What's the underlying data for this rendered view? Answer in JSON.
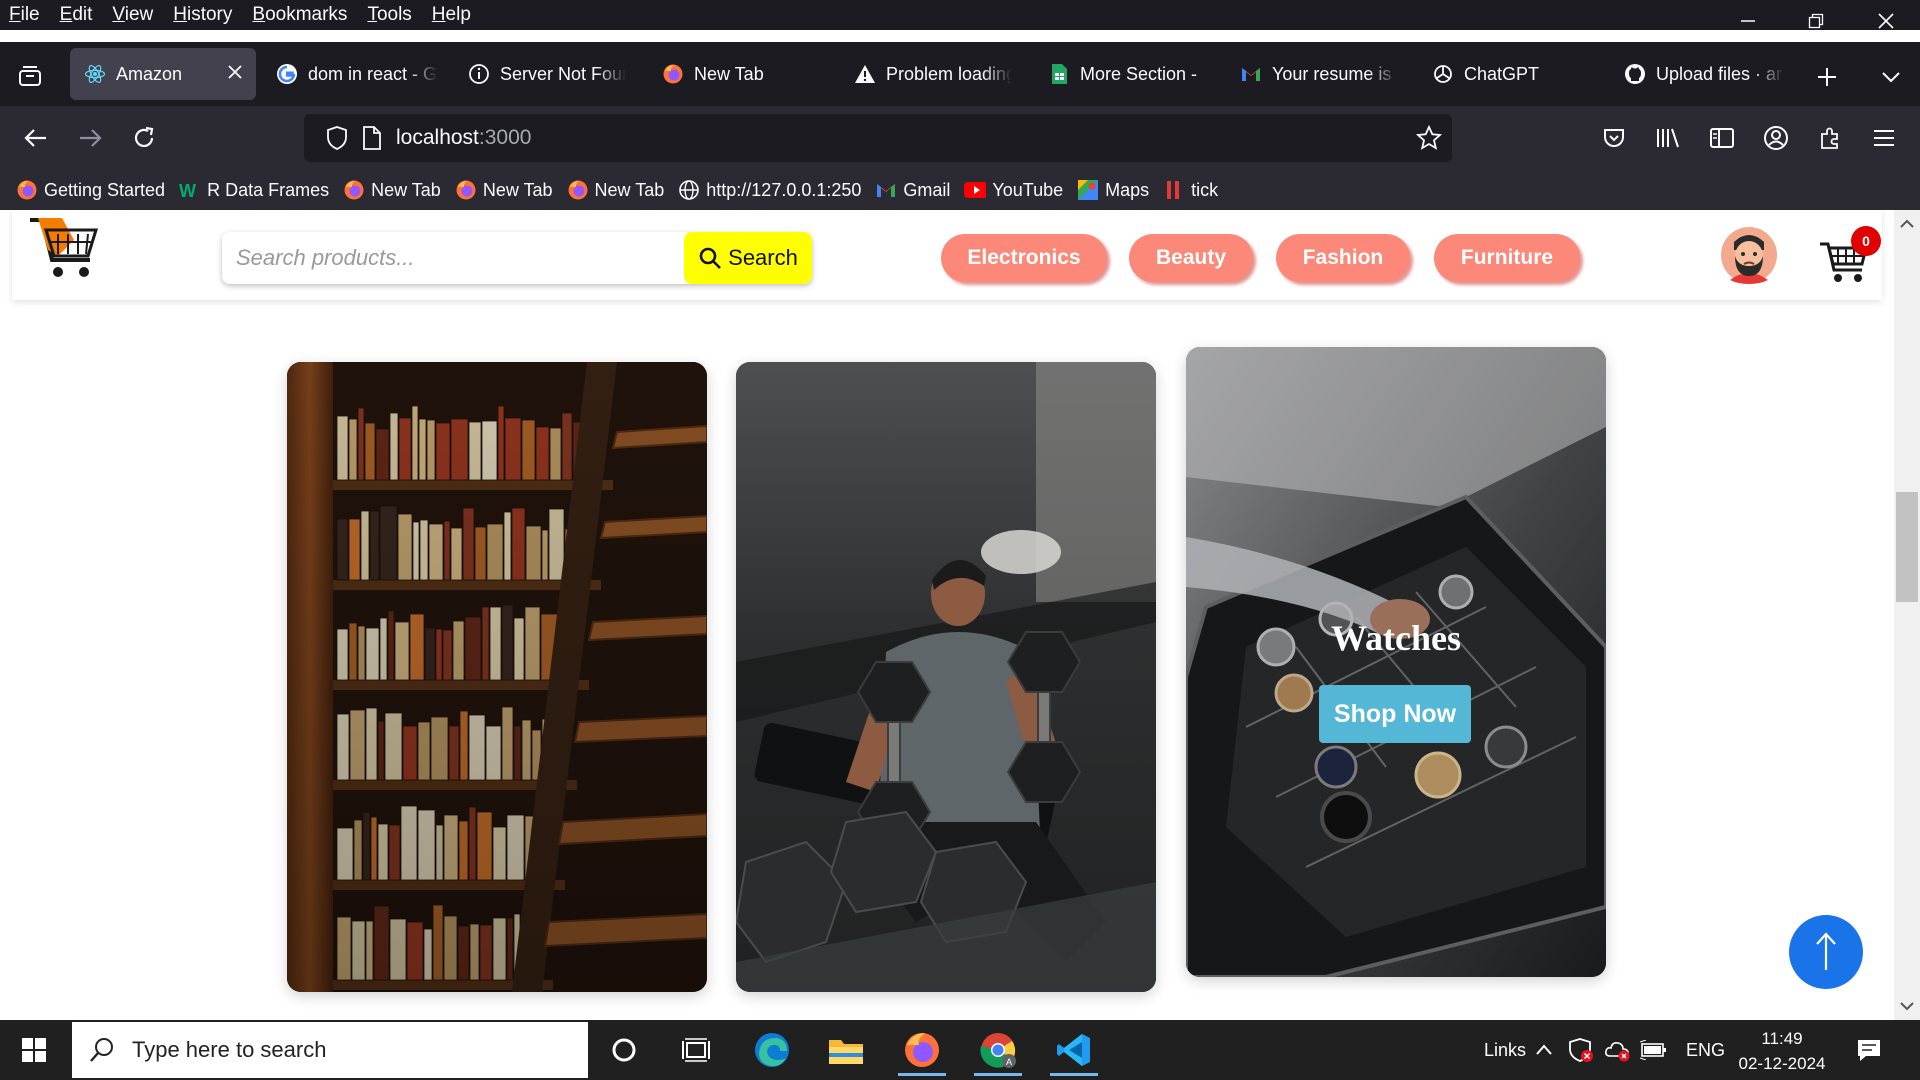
{
  "menubar": {
    "items": [
      "File",
      "Edit",
      "View",
      "History",
      "Bookmarks",
      "Tools",
      "Help"
    ]
  },
  "tabs": [
    {
      "label": "Amazon",
      "icon": "react-icon",
      "active": true
    },
    {
      "label": "dom in react - G",
      "icon": "google-icon"
    },
    {
      "label": "Server Not Found",
      "icon": "info-icon"
    },
    {
      "label": "New Tab",
      "icon": "firefox-icon"
    },
    {
      "label": "Problem loading",
      "icon": "warning-icon"
    },
    {
      "label": "More Section -",
      "icon": "sheets-icon"
    },
    {
      "label": "Your resume is",
      "icon": "gmail-icon"
    },
    {
      "label": "ChatGPT",
      "icon": "chatgpt-icon"
    },
    {
      "label": "Upload files · ar",
      "icon": "github-icon"
    }
  ],
  "urlbar": {
    "host": "localhost",
    "port": ":3000"
  },
  "bookmarks": [
    {
      "label": "Getting Started",
      "icon": "firefox-icon"
    },
    {
      "label": "R Data Frames",
      "icon": "w3schools-icon"
    },
    {
      "label": "New Tab",
      "icon": "firefox-icon"
    },
    {
      "label": "New Tab",
      "icon": "firefox-icon"
    },
    {
      "label": "New Tab",
      "icon": "firefox-icon"
    },
    {
      "label": "http://127.0.0.1:250",
      "icon": "globe-icon"
    },
    {
      "label": "Gmail",
      "icon": "gmail-icon"
    },
    {
      "label": "YouTube",
      "icon": "youtube-icon"
    },
    {
      "label": "Maps",
      "icon": "maps-icon"
    },
    {
      "label": "tick",
      "icon": "bars-icon"
    }
  ],
  "site": {
    "search": {
      "placeholder": "Search products...",
      "button": "Search"
    },
    "categories": [
      "Electronics",
      "Beauty",
      "Fashion",
      "Furniture"
    ],
    "cart_count": "0",
    "cards": [
      {
        "subject": "bookshelf"
      },
      {
        "subject": "gym dumbbells"
      },
      {
        "caption": "Watches",
        "button": "Shop Now"
      }
    ]
  },
  "taskbar": {
    "search_placeholder": "Type here to search",
    "tray_links": "Links",
    "language": "ENG",
    "time": "11:49",
    "date": "02-12-2024"
  },
  "colors": {
    "pill": "#fb8878",
    "search_button": "#ffff00",
    "shop_button": "#55b7d6",
    "scroll_top": "#1a73e8"
  }
}
